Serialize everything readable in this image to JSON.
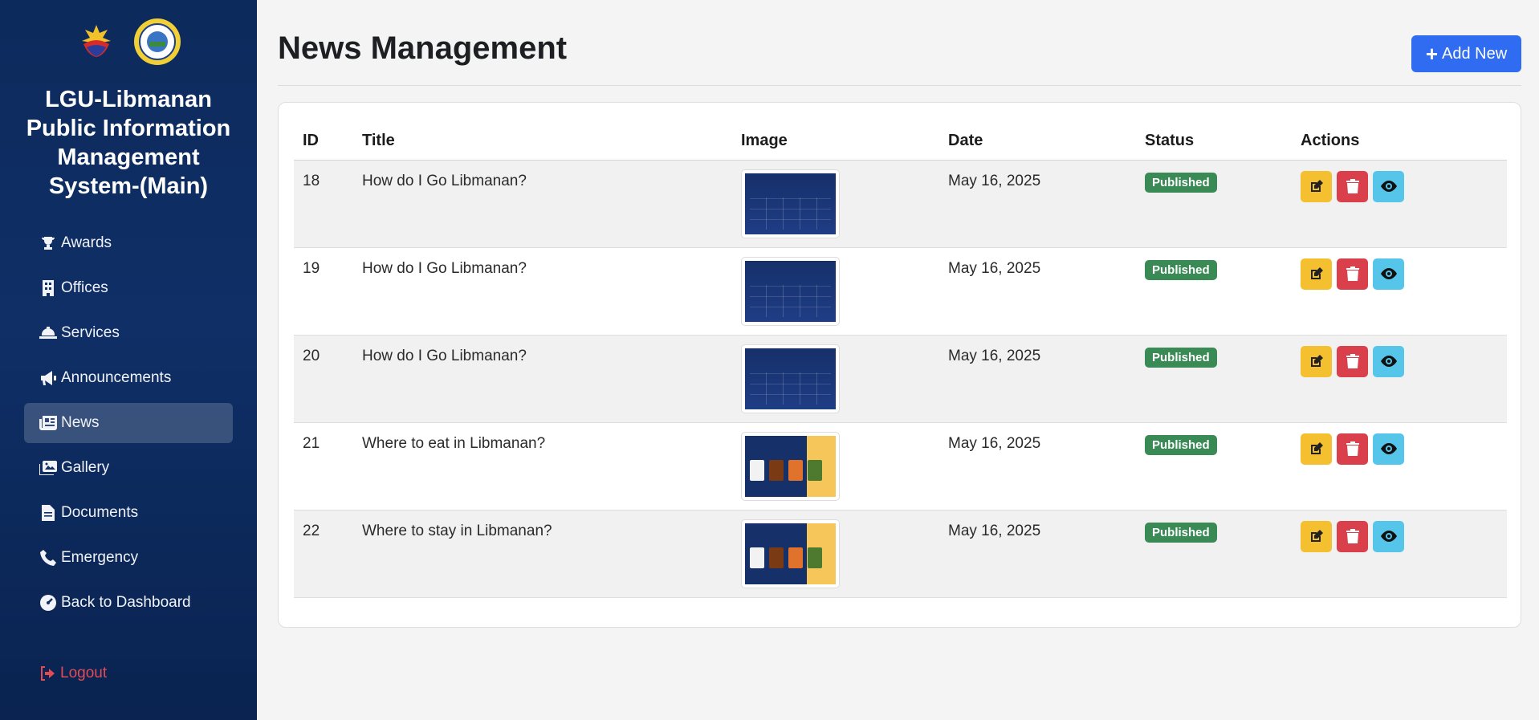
{
  "sidebar": {
    "brand": "LGU-Libmanan Public Information Management System-(Main)",
    "items": [
      {
        "label": "Awards",
        "icon": "trophy-icon",
        "active": false
      },
      {
        "label": "Offices",
        "icon": "building-icon",
        "active": false
      },
      {
        "label": "Services",
        "icon": "bell-service-icon",
        "active": false
      },
      {
        "label": "Announcements",
        "icon": "megaphone-icon",
        "active": false
      },
      {
        "label": "News",
        "icon": "newspaper-icon",
        "active": true
      },
      {
        "label": "Gallery",
        "icon": "images-icon",
        "active": false
      },
      {
        "label": "Documents",
        "icon": "file-icon",
        "active": false
      },
      {
        "label": "Emergency",
        "icon": "phone-icon",
        "active": false
      },
      {
        "label": "Back to Dashboard",
        "icon": "dashboard-gauge-icon",
        "active": false
      }
    ],
    "logout": "Logout"
  },
  "header": {
    "title": "News Management",
    "add_button": "Add New"
  },
  "table": {
    "columns": [
      "ID",
      "Title",
      "Image",
      "Date",
      "Status",
      "Actions"
    ],
    "rows": [
      {
        "id": "18",
        "title": "How do I Go Libmanan?",
        "date": "May 16, 2025",
        "status": "Published",
        "thumb": "blue"
      },
      {
        "id": "19",
        "title": "How do I Go Libmanan?",
        "date": "May 16, 2025",
        "status": "Published",
        "thumb": "blue"
      },
      {
        "id": "20",
        "title": "How do I Go Libmanan?",
        "date": "May 16, 2025",
        "status": "Published",
        "thumb": "blue"
      },
      {
        "id": "21",
        "title": "Where to eat in Libmanan?",
        "date": "May 16, 2025",
        "status": "Published",
        "thumb": "yellow"
      },
      {
        "id": "22",
        "title": "Where to stay in Libmanan?",
        "date": "May 16, 2025",
        "status": "Published",
        "thumb": "yellow"
      }
    ]
  },
  "colors": {
    "sidebar_bg": "#0d2a5c",
    "primary": "#2f6cf2",
    "published": "#3a8a56",
    "edit": "#f4c030",
    "delete": "#d9404c",
    "view": "#55c6ea",
    "logout": "#e24b56"
  }
}
